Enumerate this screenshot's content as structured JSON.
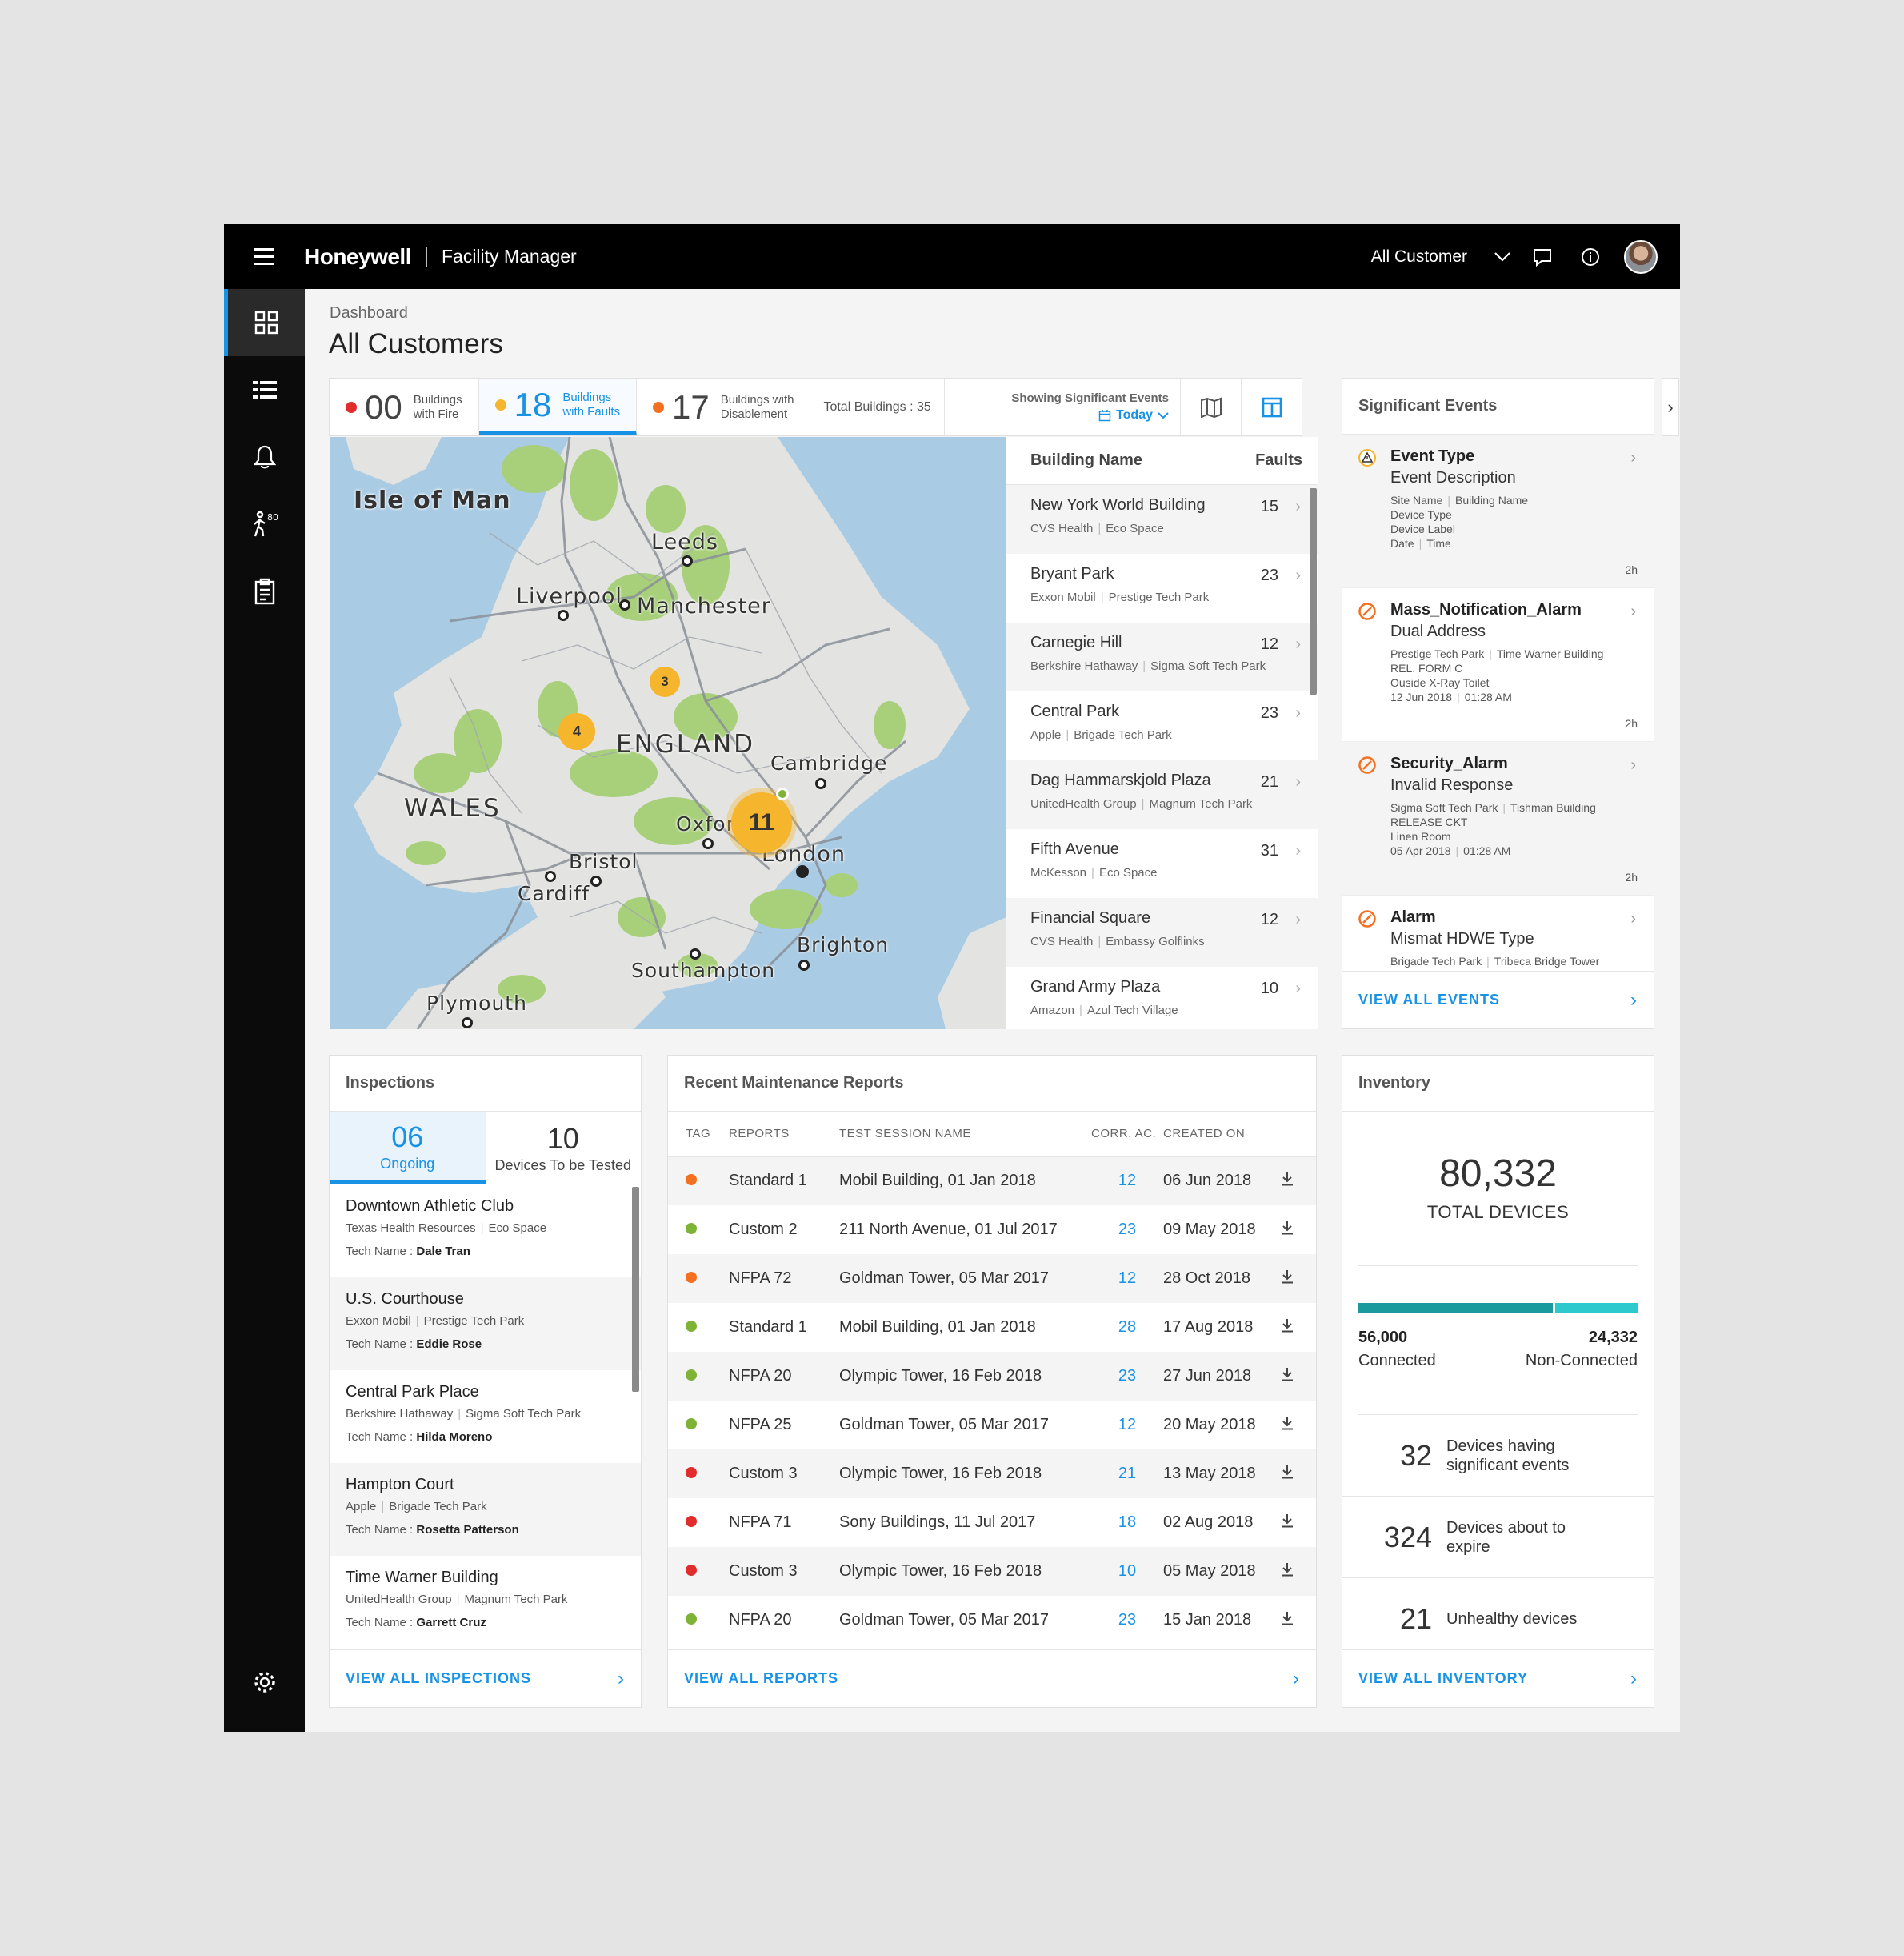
{
  "header": {
    "brand": "Honeywell",
    "app_name": "Facility Manager",
    "customer_select": "All Customer"
  },
  "page": {
    "breadcrumb": "Dashboard",
    "title": "All Customers"
  },
  "stats": {
    "fire": {
      "value": "00",
      "label1": "Buildings",
      "label2": "with Fire",
      "color": "#e02c2c"
    },
    "faults": {
      "value": "18",
      "label1": "Buildings",
      "label2": "with Faults",
      "color": "#f5b52d"
    },
    "disablement": {
      "value": "17",
      "label1": "Buildings with",
      "label2": "Disablement",
      "color": "#f37021"
    },
    "total": "Total Buildings : 35",
    "showing_label": "Showing Significant Events",
    "showing_value": "Today"
  },
  "map": {
    "labels": [
      "Isle of Man",
      "Leeds",
      "Liverpool",
      "Manchester",
      "ENGLAND",
      "Cambridge",
      "WALES",
      "Oxford",
      "London",
      "Bristol",
      "Cardiff",
      "Brighton",
      "Southampton",
      "Plymouth"
    ],
    "clusters": [
      "3",
      "4",
      "11"
    ]
  },
  "buildings": {
    "col_name": "Building Name",
    "col_faults": "Faults",
    "items": [
      {
        "name": "New York World Building",
        "faults": "15",
        "c1": "CVS Health",
        "c2": "Eco Space"
      },
      {
        "name": "Bryant Park",
        "faults": "23",
        "c1": "Exxon Mobil",
        "c2": "Prestige Tech Park"
      },
      {
        "name": "Carnegie Hill",
        "faults": "12",
        "c1": "Berkshire Hathaway",
        "c2": "Sigma Soft Tech Park"
      },
      {
        "name": "Central Park",
        "faults": "23",
        "c1": "Apple",
        "c2": "Brigade Tech Park"
      },
      {
        "name": "Dag Hammarskjold Plaza",
        "faults": "21",
        "c1": "UnitedHealth Group",
        "c2": "Magnum Tech Park"
      },
      {
        "name": "Fifth Avenue",
        "faults": "31",
        "c1": "McKesson",
        "c2": "Eco Space"
      },
      {
        "name": "Financial Square",
        "faults": "12",
        "c1": "CVS Health",
        "c2": "Embassy Golflinks"
      },
      {
        "name": "Grand Army Plaza",
        "faults": "10",
        "c1": "Amazon",
        "c2": "Azul Tech Village"
      }
    ]
  },
  "events": {
    "title": "Significant Events",
    "view_all": "VIEW ALL EVENTS",
    "items": [
      {
        "type": "Event Type",
        "desc": "Event Description",
        "l1a": "Site Name",
        "l1b": "Building Name",
        "l2": "Device Type",
        "l3": "Device Label",
        "l4a": "Date",
        "l4b": "Time",
        "ago": "2h",
        "icon": "warning-icon"
      },
      {
        "type": "Mass_Notification_Alarm",
        "desc": "Dual Address",
        "l1a": "Prestige Tech Park",
        "l1b": "Time Warner Building",
        "l2": "REL. FORM C",
        "l3": "Ouside X-Ray Toilet",
        "l4a": "12 Jun 2018",
        "l4b": "01:28 AM",
        "ago": "2h",
        "icon": "alarm-icon"
      },
      {
        "type": "Security_Alarm",
        "desc": "Invalid Response",
        "l1a": "Sigma Soft Tech Park",
        "l1b": "Tishman Building",
        "l2": "RELEASE CKT",
        "l3": "Linen Room",
        "l4a": "05 Apr 2018",
        "l4b": "01:28 AM",
        "ago": "2h",
        "icon": "alarm-icon"
      },
      {
        "type": "Alarm",
        "desc": "Mismat HDWE Type",
        "l1a": "Brigade Tech Park",
        "l1b": "Tribeca Bridge Tower",
        "l2": "",
        "l3": "",
        "l4a": "",
        "l4b": "",
        "ago": "",
        "icon": "alarm-icon"
      }
    ]
  },
  "inspections": {
    "title": "Inspections",
    "tab_ongoing": {
      "value": "06",
      "label": "Ongoing"
    },
    "tab_tested": {
      "value": "10",
      "label": "Devices To be Tested"
    },
    "tech_label": "Tech Name :",
    "view_all": "VIEW ALL INSPECTIONS",
    "items": [
      {
        "name": "Downtown Athletic Club",
        "c1": "Texas Health Resources",
        "c2": "Eco Space",
        "tech": "Dale Tran"
      },
      {
        "name": "U.S. Courthouse",
        "c1": "Exxon Mobil",
        "c2": "Prestige Tech Park",
        "tech": "Eddie Rose"
      },
      {
        "name": "Central Park Place",
        "c1": "Berkshire Hathaway",
        "c2": "Sigma Soft Tech Park",
        "tech": "Hilda Moreno"
      },
      {
        "name": "Hampton Court",
        "c1": "Apple",
        "c2": "Brigade Tech Park",
        "tech": "Rosetta Patterson"
      },
      {
        "name": "Time Warner Building",
        "c1": "UnitedHealth Group",
        "c2": "Magnum Tech Park",
        "tech": "Garrett Cruz"
      }
    ]
  },
  "reports": {
    "title": "Recent Maintenance Reports",
    "cols": {
      "tag": "TAG",
      "reports": "REPORTS",
      "session": "TEST SESSION NAME",
      "corr": "CORR. AC.",
      "created": "CREATED ON"
    },
    "view_all": "VIEW ALL REPORTS",
    "rows": [
      {
        "color": "#f37021",
        "report": "Standard 1",
        "session": "Mobil Building, 01 Jan 2018",
        "corr": "12",
        "created": "06 Jun 2018"
      },
      {
        "color": "#7eb338",
        "report": "Custom 2",
        "session": "211 North Avenue, 01 Jul 2017",
        "corr": "23",
        "created": "09 May 2018"
      },
      {
        "color": "#f37021",
        "report": "NFPA 72",
        "session": "Goldman Tower, 05 Mar 2017",
        "corr": "12",
        "created": "28 Oct 2018"
      },
      {
        "color": "#7eb338",
        "report": "Standard 1",
        "session": "Mobil Building, 01 Jan 2018",
        "corr": "28",
        "created": "17 Aug 2018"
      },
      {
        "color": "#7eb338",
        "report": "NFPA 20",
        "session": "Olympic Tower, 16 Feb 2018",
        "corr": "23",
        "created": "27 Jun 2018"
      },
      {
        "color": "#7eb338",
        "report": "NFPA 25",
        "session": "Goldman Tower, 05 Mar 2017",
        "corr": "12",
        "created": "20 May 2018"
      },
      {
        "color": "#e02c2c",
        "report": "Custom 3",
        "session": "Olympic Tower, 16 Feb 2018",
        "corr": "21",
        "created": "13 May 2018"
      },
      {
        "color": "#e02c2c",
        "report": "NFPA 71",
        "session": "Sony Buildings, 11 Jul 2017",
        "corr": "18",
        "created": "02 Aug 2018"
      },
      {
        "color": "#e02c2c",
        "report": "Custom 3",
        "session": "Olympic Tower, 16 Feb 2018",
        "corr": "10",
        "created": "05 May 2018"
      },
      {
        "color": "#7eb338",
        "report": "NFPA 20",
        "session": "Goldman Tower, 05 Mar 2017",
        "corr": "23",
        "created": "15 Jan 2018"
      }
    ]
  },
  "inventory": {
    "title": "Inventory",
    "total": "80,332",
    "total_label": "TOTAL DEVICES",
    "connected_value": "56,000",
    "connected_label": "Connected",
    "connected_fraction": 0.697,
    "non_connected_value": "24,332",
    "non_connected_label": "Non-Connected",
    "stats": [
      {
        "value": "32",
        "label": "Devices having significant events"
      },
      {
        "value": "324",
        "label": "Devices about to expire"
      },
      {
        "value": "21",
        "label": "Unhealthy devices"
      }
    ],
    "view_all": "VIEW ALL INVENTORY"
  },
  "colors": {
    "accent": "#1792e5",
    "topbar": "#000000",
    "sidebar": "#0b0b0b"
  }
}
